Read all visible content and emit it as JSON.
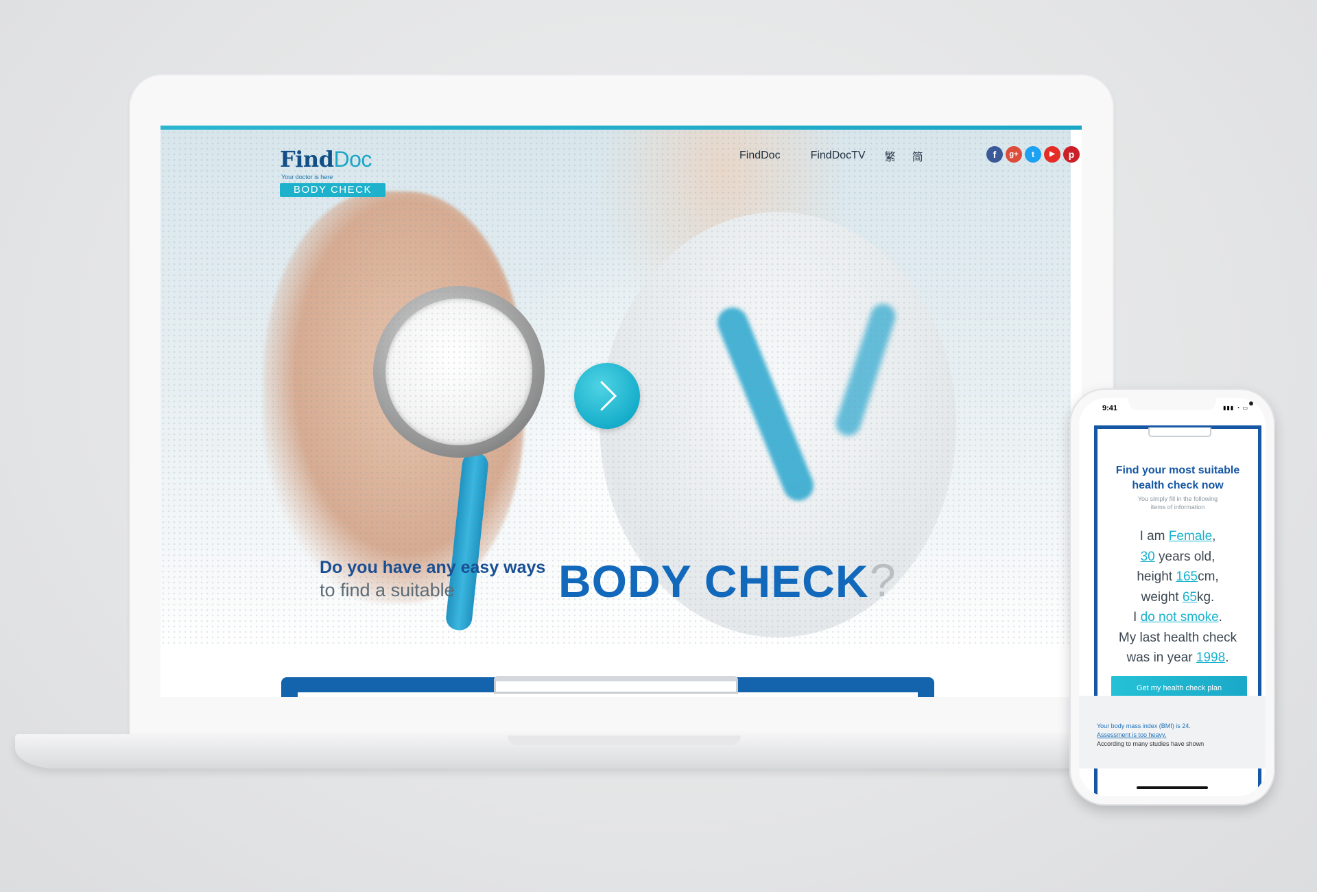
{
  "header": {
    "logo": {
      "brand_main": "Find",
      "brand_accent": "Doc",
      "tagline": "Your doctor is here",
      "badge": "BODY CHECK"
    },
    "nav": [
      {
        "label": "FindDoc"
      },
      {
        "label": "FindDocTV"
      }
    ],
    "languages": [
      "繁",
      "简"
    ],
    "socials": [
      {
        "name": "facebook-icon",
        "glyph": "f"
      },
      {
        "name": "google-plus-icon",
        "glyph": "g+"
      },
      {
        "name": "twitter-icon",
        "glyph": "t"
      },
      {
        "name": "youtube-icon",
        "glyph": "▶"
      },
      {
        "name": "pinterest-icon",
        "glyph": "p"
      }
    ]
  },
  "hero": {
    "question_line1": "Do you have any easy ways",
    "question_line2": "to find a suitable",
    "headline": "BODY CHECK",
    "question_mark": "?"
  },
  "phone": {
    "status_time": "9:41",
    "status_icons": "▮▮▮ ◔ ▭",
    "title_line1": "Find your most suitable",
    "title_line2": "health check now",
    "subtitle_line1": "You simply fill in the following",
    "subtitle_line2": "items of information",
    "form": {
      "i_am": "I am",
      "gender": "Female",
      "age": "30",
      "years_old": "years old,",
      "height_label": "height",
      "height": "165",
      "cm": "cm,",
      "weight_label": "weight",
      "weight": "65",
      "kg": "kg.",
      "i": "I",
      "smoking": "do not smoke",
      "period": ".",
      "last_check_1": "My last health check",
      "last_check_2": "was in year",
      "year": "1998",
      "period2": "."
    },
    "cta": "Get my health check plan",
    "bmi_line1": "Your body mass index (BMI) is 24.",
    "bmi_line2": "Assessment is too heavy.",
    "bmi_line3": "According to many studies have shown"
  },
  "colors": {
    "brand_blue": "#1268ba",
    "accent_teal": "#1eb1cc"
  }
}
